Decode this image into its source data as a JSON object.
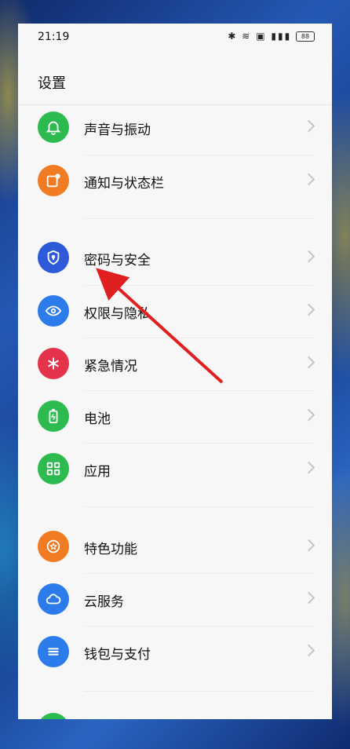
{
  "status_bar": {
    "time": "21:19",
    "battery": "88",
    "icons": [
      "bluetooth-icon",
      "wifi-icon",
      "hd-icon",
      "5g-signal-icon"
    ]
  },
  "page": {
    "title": "设置"
  },
  "items": [
    {
      "label": "声音与振动",
      "icon": "bell-icon",
      "color": "#2dbb4f"
    },
    {
      "label": "通知与状态栏",
      "icon": "notification-icon",
      "color": "#f07b22"
    },
    {
      "label": "密码与安全",
      "icon": "shield-icon",
      "color": "#2e59d9"
    },
    {
      "label": "权限与隐私",
      "icon": "eye-lock-icon",
      "color": "#2b7cea"
    },
    {
      "label": "紧急情况",
      "icon": "asterisk-icon",
      "color": "#e5334b"
    },
    {
      "label": "电池",
      "icon": "battery-icon",
      "color": "#2dbb4f"
    },
    {
      "label": "应用",
      "icon": "grid-icon",
      "color": "#2dbb4f"
    },
    {
      "label": "特色功能",
      "icon": "star-icon",
      "color": "#f07b22"
    },
    {
      "label": "云服务",
      "icon": "cloud-icon",
      "color": "#2b7cea"
    },
    {
      "label": "钱包与支付",
      "icon": "wallet-icon",
      "color": "#2b7cea"
    }
  ],
  "annotation": {
    "type": "red-arrow",
    "points_to": "密码与安全"
  }
}
